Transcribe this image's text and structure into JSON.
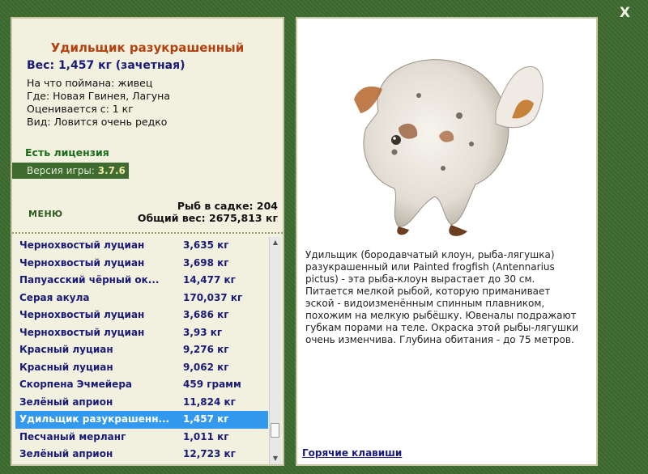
{
  "close_label": "X",
  "fish": {
    "title": "Удильщик разукрашенный",
    "weight": "Вес: 1,457 кг (зачетная)",
    "caught_on": "На что поймана: живец",
    "where": "Где: Новая Гвинея, Лагуна",
    "rated_from": "Оценивается с: 1 кг",
    "kind": "Вид: Ловится очень редко",
    "description": "Удильщик (бородавчатый клоун, рыба-лягушка) разукрашенный или Painted frogfish (Antennarius pictus) - эта рыба-клоун вырастает до 30 см. Питается мелкой рыбой, которую приманивает эской - видоизменённым спинным плавником, похожим на мелкую рыбёшку. Ювеналы подражают губкам порами на теле. Окраска этой рыбы-лягушки очень изменчива. Глубина обитания - до 75 метров."
  },
  "license": "Есть лицензия",
  "version": {
    "label": "Версия игры: ",
    "value": "3.7.6"
  },
  "menu_label": "МЕНЮ",
  "stats": {
    "fish_in_keepnet": "Рыб в садке: 204",
    "total_weight": "Общий вес: 2675,813 кг"
  },
  "catch_list": [
    {
      "name": "Чернохвостый луциан",
      "weight": "3,635 кг"
    },
    {
      "name": "Чернохвостый луциан",
      "weight": "3,698 кг"
    },
    {
      "name": "Папуасский чёрный ок...",
      "weight": "14,477 кг"
    },
    {
      "name": "Серая акула",
      "weight": "170,037 кг"
    },
    {
      "name": "Чернохвостый луциан",
      "weight": "3,686 кг"
    },
    {
      "name": "Чернохвостый луциан",
      "weight": "3,93 кг"
    },
    {
      "name": "Красный луциан",
      "weight": "9,276 кг"
    },
    {
      "name": "Красный луциан",
      "weight": "9,062 кг"
    },
    {
      "name": "Скорпена Эчмейера",
      "weight": "459 грамм"
    },
    {
      "name": "Зелёный априон",
      "weight": "11,824 кг"
    },
    {
      "name": "Удильщик разукрашенн...",
      "weight": "1,457 кг",
      "selected": true
    },
    {
      "name": "Песчаный мерланг",
      "weight": "1,011 кг"
    },
    {
      "name": "Зелёный априон",
      "weight": "12,723 кг"
    }
  ],
  "hotkeys_label": "Горячие клавиши",
  "colors": {
    "background": "#3e6b30",
    "title": "#b3400f",
    "list_text": "#1a1a78",
    "selected": "#3399ee"
  }
}
